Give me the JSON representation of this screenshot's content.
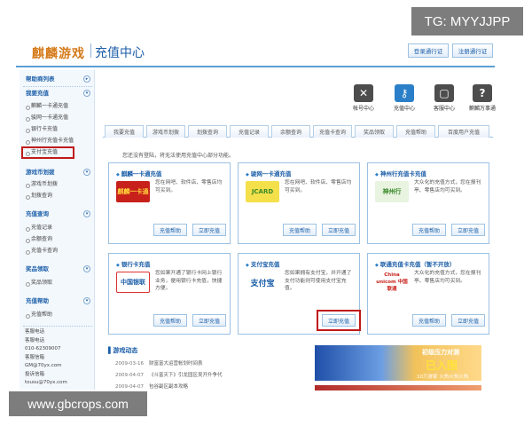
{
  "watermark_top": "TG: MYYJJPP",
  "watermark_bottom": "www.gbcrops.com",
  "header": {
    "logo": "麒麟游戏",
    "title": "充值中心",
    "btn_login": "登录通行证",
    "btn_register": "注册通行证"
  },
  "sidebar": {
    "sections": [
      {
        "title": "帮助商列表",
        "items": []
      },
      {
        "title": "我要充值",
        "items": [
          "麒麟一卡通充值",
          "骏网一卡通充值",
          "银行卡充值",
          "神州行充值卡充值",
          "支付宝充值"
        ]
      },
      {
        "title": "游戏币划拨",
        "items": [
          "游戏币划拨",
          "划拨查询"
        ]
      },
      {
        "title": "充值查询",
        "items": [
          "充值记录",
          "余额查询",
          "充值卡查询"
        ]
      },
      {
        "title": "奖品领取",
        "items": [
          "奖品领取"
        ]
      },
      {
        "title": "充值帮助",
        "items": [
          "充值帮助"
        ]
      }
    ],
    "contact": [
      "客服电话",
      "客服电话",
      "010-62309007",
      "客服信箱",
      "GM@70yx.com",
      "投诉信箱",
      "tousu@70yx.com"
    ]
  },
  "icons": [
    {
      "name": "wrench-icon",
      "glyph": "✕",
      "label": "帐号中心"
    },
    {
      "name": "key-icon",
      "glyph": "⚷",
      "label": "充值中心"
    },
    {
      "name": "chat-icon",
      "glyph": "▢",
      "label": "客服中心"
    },
    {
      "name": "question-icon",
      "glyph": "?",
      "label": "麒麟万事通"
    }
  ],
  "tabs": [
    "我要充值",
    "游戏币划拨",
    "划拨查询",
    "充值记录",
    "余额查询",
    "充值卡查询",
    "奖品领取",
    "充值帮助",
    "百度用户充值"
  ],
  "notice": "您还没有登陆，将无法使用充值中心部分功能。",
  "cards": [
    {
      "title": "麒麟一卡通充值",
      "logo": "麒麟一卡通",
      "desc": "您在网吧、软件店、零售店均可买到。",
      "btn1": "充值帮助",
      "btn2": "立即充值"
    },
    {
      "title": "骏网一卡通充值",
      "logo": "JCARD",
      "desc": "您在网吧、软件店、零售店均可买到。",
      "btn1": "充值帮助",
      "btn2": "立即充值"
    },
    {
      "title": "神州行充值卡充值",
      "logo": "神州行",
      "desc": "大众化的充值方式，您在报刊亭、零售店均可买到。",
      "btn1": "充值帮助",
      "btn2": "立即充值"
    },
    {
      "title": "银行卡充值",
      "logo": "中国银联",
      "desc": "您如果开通了银行卡网上银行业务，便用银行卡充值，快捷方便。",
      "btn1": "充值帮助",
      "btn2": "立即充值"
    },
    {
      "title": "支付宝充值",
      "logo": "支付宝",
      "desc": "您如果拥有支付宝，并开通了支付功能则可使用支付宝充值。",
      "btn1": "充值帮助",
      "btn2": "立即充值"
    },
    {
      "title": "联通充值卡充值（暂不开放）",
      "logo": "China unicom 中国联通",
      "desc": "大众化的充值方式，您在报刊亭、零售店均可买到。",
      "btn1": "充值帮助",
      "btn2": "立即充值"
    }
  ],
  "news": {
    "title": "游戏动态",
    "items": [
      {
        "date": "2009-03-16",
        "text": "财富富大运营帐划时间表"
      },
      {
        "date": "2009-04-07",
        "text": "《斗富天下》引龙园区吴开升争代"
      },
      {
        "date": "2009-04-07",
        "text": "包谷副区副本攻略"
      }
    ]
  },
  "banner": {
    "line1": "初级压力对测",
    "line2": "已入围",
    "line3": "10万游家 火热火热火热"
  }
}
